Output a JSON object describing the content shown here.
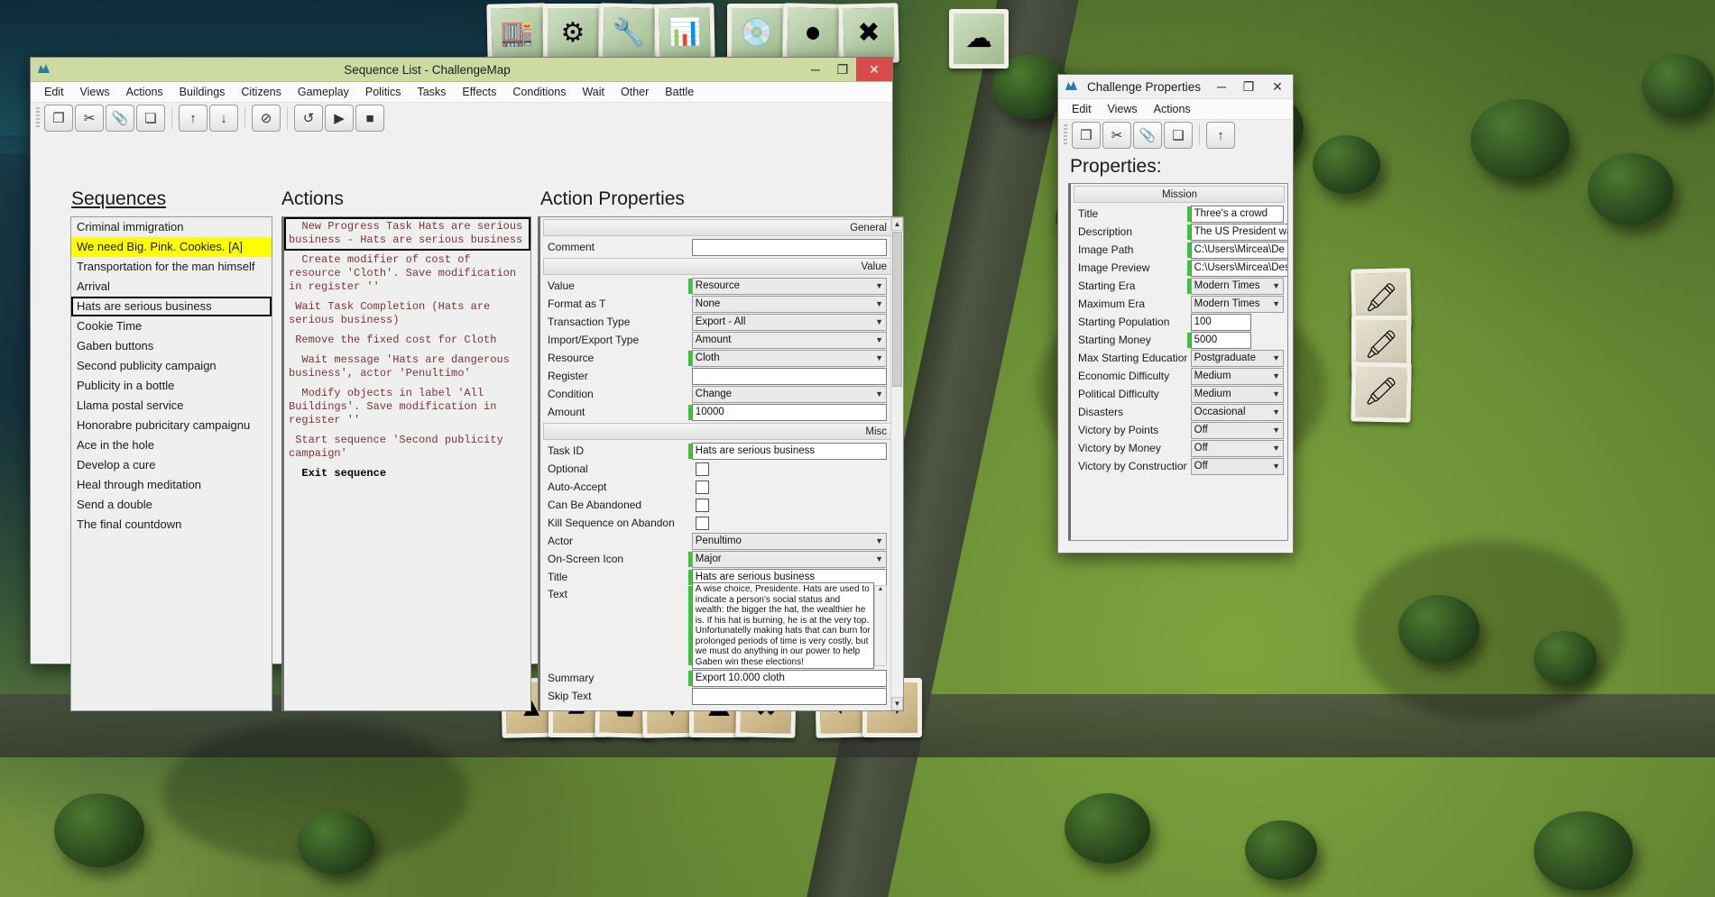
{
  "background": {
    "scene": "tropico-island-terrain"
  },
  "top_toolbar": {
    "stamps": [
      {
        "name": "buildings-stamp",
        "glyph": "🏬"
      },
      {
        "name": "gear-stamp",
        "glyph": "⚙"
      },
      {
        "name": "wrench-stamp",
        "glyph": "🔧"
      },
      {
        "name": "charts-stamp",
        "glyph": "📊"
      },
      {
        "name": "disc-stamp",
        "glyph": "💿"
      },
      {
        "name": "disc-play-stamp",
        "glyph": "⏺"
      },
      {
        "name": "delete-stamp",
        "glyph": "✖"
      },
      {
        "name": "cloud-upload-stamp",
        "glyph": "☁"
      }
    ]
  },
  "bottom_toolbar": {
    "stamps": [
      {
        "name": "terrain-raise-stamp",
        "glyph": "▲"
      },
      {
        "name": "terrain-flatten-stamp",
        "glyph": "▰"
      },
      {
        "name": "terrain-plateau-stamp",
        "glyph": "⬟"
      },
      {
        "name": "terrain-lower-stamp",
        "glyph": "▼"
      },
      {
        "name": "rock-stamp",
        "glyph": "⛰"
      },
      {
        "name": "foliage-delete-stamp",
        "glyph": "✖"
      },
      {
        "name": "undo-stamp",
        "glyph": "⬅"
      },
      {
        "name": "redo-stamp",
        "glyph": "➡"
      }
    ]
  },
  "sequence_window": {
    "title": "Sequence List - ChallengeMap",
    "title_icon": "app-icon",
    "window_buttons": {
      "minimize": "─",
      "maximize": "❐",
      "close": "✕"
    },
    "menu": [
      "Edit",
      "Views",
      "Actions",
      "Buildings",
      "Citizens",
      "Gameplay",
      "Politics",
      "Tasks",
      "Effects",
      "Conditions",
      "Wait",
      "Other",
      "Battle"
    ],
    "toolbar_icons": [
      {
        "name": "copy-icon",
        "glyph": "❐"
      },
      {
        "name": "cut-icon",
        "glyph": "✂"
      },
      {
        "name": "paste-icon",
        "glyph": "📎"
      },
      {
        "name": "duplicate-icon",
        "glyph": "❏"
      },
      {
        "name": "move-up-icon",
        "glyph": "↑"
      },
      {
        "name": "move-down-icon",
        "glyph": "↓"
      },
      {
        "name": "disable-icon",
        "glyph": "⊘"
      },
      {
        "name": "reload-icon",
        "glyph": "↺"
      },
      {
        "name": "play-icon",
        "glyph": "▶"
      },
      {
        "name": "stop-icon",
        "glyph": "■"
      }
    ],
    "sequences_header": "Sequences",
    "sequences": [
      {
        "label": "Criminal immigration",
        "state": "normal"
      },
      {
        "label": "We need Big. Pink. Cookies.    [A]",
        "state": "highlight"
      },
      {
        "label": "Transportation for the man himself",
        "state": "normal"
      },
      {
        "label": "Arrival",
        "state": "normal"
      },
      {
        "label": "Hats are serious business",
        "state": "selected"
      },
      {
        "label": "Cookie Time",
        "state": "normal"
      },
      {
        "label": "Gaben buttons",
        "state": "normal"
      },
      {
        "label": "Second publicity campaign",
        "state": "normal"
      },
      {
        "label": "Publicity in a bottle",
        "state": "normal"
      },
      {
        "label": "Llama postal service",
        "state": "normal"
      },
      {
        "label": "Honorabre pubricitary campaignu",
        "state": "normal"
      },
      {
        "label": "Ace in the hole",
        "state": "normal"
      },
      {
        "label": "Develop a cure",
        "state": "normal"
      },
      {
        "label": "Heal through meditation",
        "state": "normal"
      },
      {
        "label": "Send a double",
        "state": "normal"
      },
      {
        "label": "The final countdown",
        "state": "normal"
      }
    ],
    "actions_header": "Actions",
    "actions": [
      {
        "text": "  New Progress Task Hats are serious business - Hats are serious business",
        "state": "selected"
      },
      {
        "text": "  Create modifier of cost of resource 'Cloth'. Save modification in register ''",
        "state": "normal"
      },
      {
        "text": " Wait Task Completion (Hats are serious business)",
        "state": "normal"
      },
      {
        "text": " Remove the fixed cost for Cloth",
        "state": "normal"
      },
      {
        "text": "  Wait message 'Hats are dangerous business', actor 'Penultimo'",
        "state": "normal"
      },
      {
        "text": "  Modify objects in label 'All Buildings'. Save modification in register ''",
        "state": "normal"
      },
      {
        "text": " Start sequence 'Second publicity campaign'",
        "state": "normal"
      },
      {
        "text": "  Exit sequence",
        "state": "bold"
      }
    ],
    "properties_header": "Action Properties",
    "groups": [
      {
        "name": "General",
        "rows": [
          {
            "label": "Comment",
            "type": "input",
            "value": "",
            "accent": false,
            "readonly": false
          }
        ]
      },
      {
        "name": "Value",
        "rows": [
          {
            "label": "Value",
            "type": "select",
            "value": "Resource",
            "accent": true
          },
          {
            "label": "Format as T",
            "type": "select",
            "value": "None",
            "accent": false
          },
          {
            "label": "Transaction Type",
            "type": "select",
            "value": "Export - All",
            "accent": false
          },
          {
            "label": "Import/Export Type",
            "type": "select",
            "value": "Amount",
            "accent": false
          },
          {
            "label": "Resource",
            "type": "select",
            "value": "Cloth",
            "accent": true
          },
          {
            "label": "Register",
            "type": "input",
            "value": "",
            "accent": false
          },
          {
            "label": "Condition",
            "type": "select",
            "value": "Change",
            "accent": false
          },
          {
            "label": "Amount",
            "type": "input",
            "value": "10000",
            "accent": true
          }
        ]
      },
      {
        "name": "Misc",
        "rows": [
          {
            "label": "Task ID",
            "type": "input",
            "value": "Hats are serious business",
            "accent": true
          },
          {
            "label": "Optional",
            "type": "checkbox",
            "checked": false,
            "accent": false
          },
          {
            "label": "Auto-Accept",
            "type": "checkbox",
            "checked": false,
            "accent": false
          },
          {
            "label": "Can Be Abandoned",
            "type": "checkbox",
            "checked": false,
            "accent": false
          },
          {
            "label": "Kill Sequence on Abandon",
            "type": "checkbox",
            "checked": false,
            "accent": false
          },
          {
            "label": "Actor",
            "type": "select",
            "value": "Penultimo",
            "accent": false
          },
          {
            "label": "On-Screen Icon",
            "type": "select",
            "value": "Major",
            "accent": true
          },
          {
            "label": "Title",
            "type": "input",
            "value": "Hats are serious business",
            "accent": true
          },
          {
            "label": "Text",
            "type": "textarea",
            "value": "A wise choice, Presidente. Hats are used to indicate a person's social status and wealth: the bigger the hat, the wealthier he is. If his hat is burning, he is at the very top. Unfortunatelly making hats that can burn for prolonged periods of time is very costly, but we must do anything in our power to help Gaben win these elections!",
            "accent": true
          },
          {
            "label": "Summary",
            "type": "input",
            "value": "Export 10.000 cloth",
            "accent": true
          },
          {
            "label": "Skip Text",
            "type": "input",
            "value": "",
            "accent": false
          }
        ]
      }
    ]
  },
  "challenge_window": {
    "title": "Challenge Properties",
    "window_buttons": {
      "minimize": "─",
      "maximize": "❐",
      "close": "✕"
    },
    "menu": [
      "Edit",
      "Views",
      "Actions"
    ],
    "toolbar_icons": [
      {
        "name": "copy-icon",
        "glyph": "❐"
      },
      {
        "name": "cut-icon",
        "glyph": "✂"
      },
      {
        "name": "paste-icon",
        "glyph": "📎"
      },
      {
        "name": "duplicate-icon",
        "glyph": "❏"
      },
      {
        "name": "move-up-icon",
        "glyph": "↑"
      }
    ],
    "properties_header": "Properties:",
    "group_name": "Mission",
    "rows": [
      {
        "label": "Title",
        "type": "input",
        "value": "Three's a crowd",
        "accent": true
      },
      {
        "label": "Description",
        "type": "input",
        "value": "The US President wants you",
        "accent": true
      },
      {
        "label": "Image Path",
        "type": "input-browse",
        "value": "C:\\Users\\Mircea\\De",
        "browse_label": "...",
        "accent": true
      },
      {
        "label": "Image Preview",
        "type": "input",
        "value": "C:\\Users\\Mircea\\Desktop\\A",
        "accent": true
      },
      {
        "label": "Starting Era",
        "type": "select",
        "value": "Modern Times",
        "accent": true
      },
      {
        "label": "Maximum Era",
        "type": "select",
        "value": "Modern Times",
        "accent": false
      },
      {
        "label": "Starting Population",
        "type": "input-short",
        "value": "100",
        "accent": false
      },
      {
        "label": "Starting Money",
        "type": "input-short",
        "value": "5000",
        "accent": true
      },
      {
        "label": "Max Starting Education",
        "type": "select",
        "value": "Postgraduate",
        "accent": false
      },
      {
        "label": "Economic Difficulty",
        "type": "select",
        "value": "Medium",
        "accent": false
      },
      {
        "label": "Political Difficulty",
        "type": "select",
        "value": "Medium",
        "accent": false
      },
      {
        "label": "Disasters",
        "type": "select",
        "value": "Occasional",
        "accent": false
      },
      {
        "label": "Victory by Points",
        "type": "select",
        "value": "Off",
        "accent": false
      },
      {
        "label": "Victory by Money",
        "type": "select",
        "value": "Off",
        "accent": false
      },
      {
        "label": "Victory by Construction",
        "type": "select",
        "value": "Off",
        "accent": false
      }
    ]
  }
}
